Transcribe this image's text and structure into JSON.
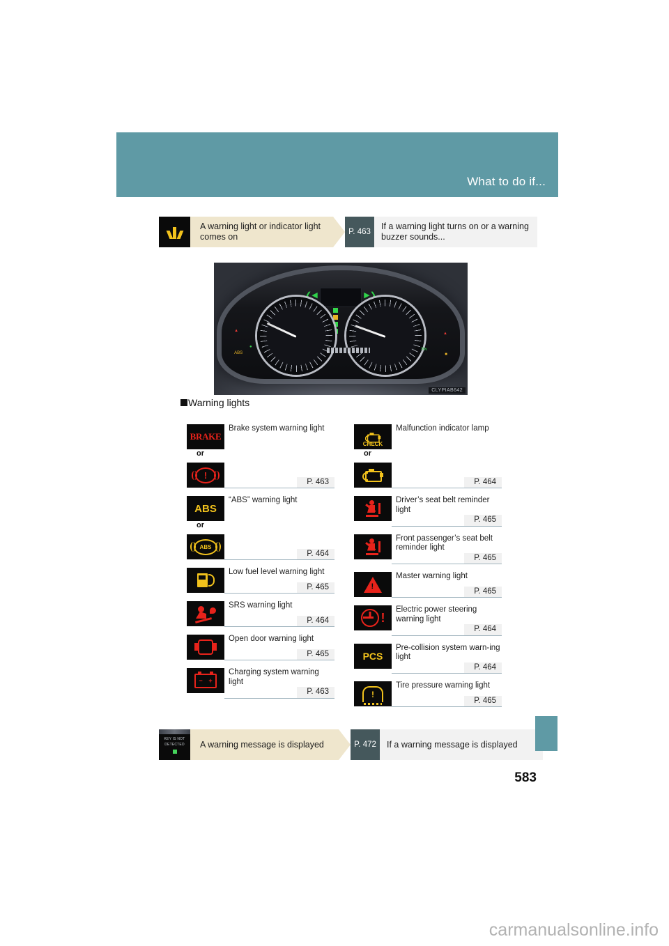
{
  "header": {
    "title": "What to do if..."
  },
  "top_callout": {
    "icon": "master-warning-rays-icon",
    "trigger_label": "A warning light or indicator light comes on",
    "page_ref": "P. 463",
    "result_label": "If a warning light turns on or a warning buzzer sounds..."
  },
  "photo": {
    "caption": "CLYPIAB642",
    "alt": "instrument-cluster-photo"
  },
  "section": {
    "heading": "Warning lights"
  },
  "warning_lights": {
    "left_column": [
      {
        "symbols": [
          "BRAKE",
          "brake-circle-exclamation"
        ],
        "or_label": "or",
        "label": "Brake system warning light",
        "page_ref": "P. 463"
      },
      {
        "symbols": [
          "ABS",
          "abs-circle"
        ],
        "or_label": "or",
        "label": "“ABS” warning light",
        "page_ref": "P. 464"
      },
      {
        "symbols": [
          "fuel-pump"
        ],
        "label": "Low fuel level warning light",
        "page_ref": "P. 465"
      },
      {
        "symbols": [
          "srs-airbag"
        ],
        "label": "SRS warning light",
        "page_ref": "P. 464"
      },
      {
        "symbols": [
          "open-door"
        ],
        "label": "Open door warning light",
        "page_ref": "P. 465"
      },
      {
        "symbols": [
          "battery"
        ],
        "label": "Charging system warning light",
        "page_ref": "P. 463"
      }
    ],
    "right_column": [
      {
        "symbols": [
          "check-engine-text",
          "engine-outline"
        ],
        "or_label": "or",
        "label": "Malfunction indicator lamp",
        "page_ref": "P. 464"
      },
      {
        "symbols": [
          "seat-belt"
        ],
        "label": "Driver’s seat belt reminder light",
        "page_ref": "P. 465"
      },
      {
        "symbols": [
          "seat-belt"
        ],
        "label": "Front passenger’s seat belt reminder light",
        "page_ref": "P. 465"
      },
      {
        "symbols": [
          "master-warning-triangle"
        ],
        "label": "Master warning light",
        "page_ref": "P. 465"
      },
      {
        "symbols": [
          "electric-power-steering"
        ],
        "label": "Electric power steering warning light",
        "page_ref": "P. 464"
      },
      {
        "symbols": [
          "PCS"
        ],
        "label": "Pre-collision system warn-ing light",
        "page_ref": "P. 464"
      },
      {
        "symbols": [
          "tire-pressure"
        ],
        "label": "Tire pressure warning light",
        "page_ref": "P. 465"
      }
    ]
  },
  "bottom_callout": {
    "icon_text_line1": "KEY IS NOT",
    "icon_text_line2": "DETECTED",
    "trigger_label": "A warning message is displayed",
    "page_ref": "P. 472",
    "result_label": "If a warning message is displayed"
  },
  "page_number": "583",
  "watermark": "carmanualsonline.info",
  "colors": {
    "teal": "#5f9aa5",
    "cream": "#efe6cd",
    "slate": "#45585c",
    "light_gray": "#f2f2f2",
    "warn_red": "#e8231b",
    "warn_yellow": "#f2c21c"
  }
}
